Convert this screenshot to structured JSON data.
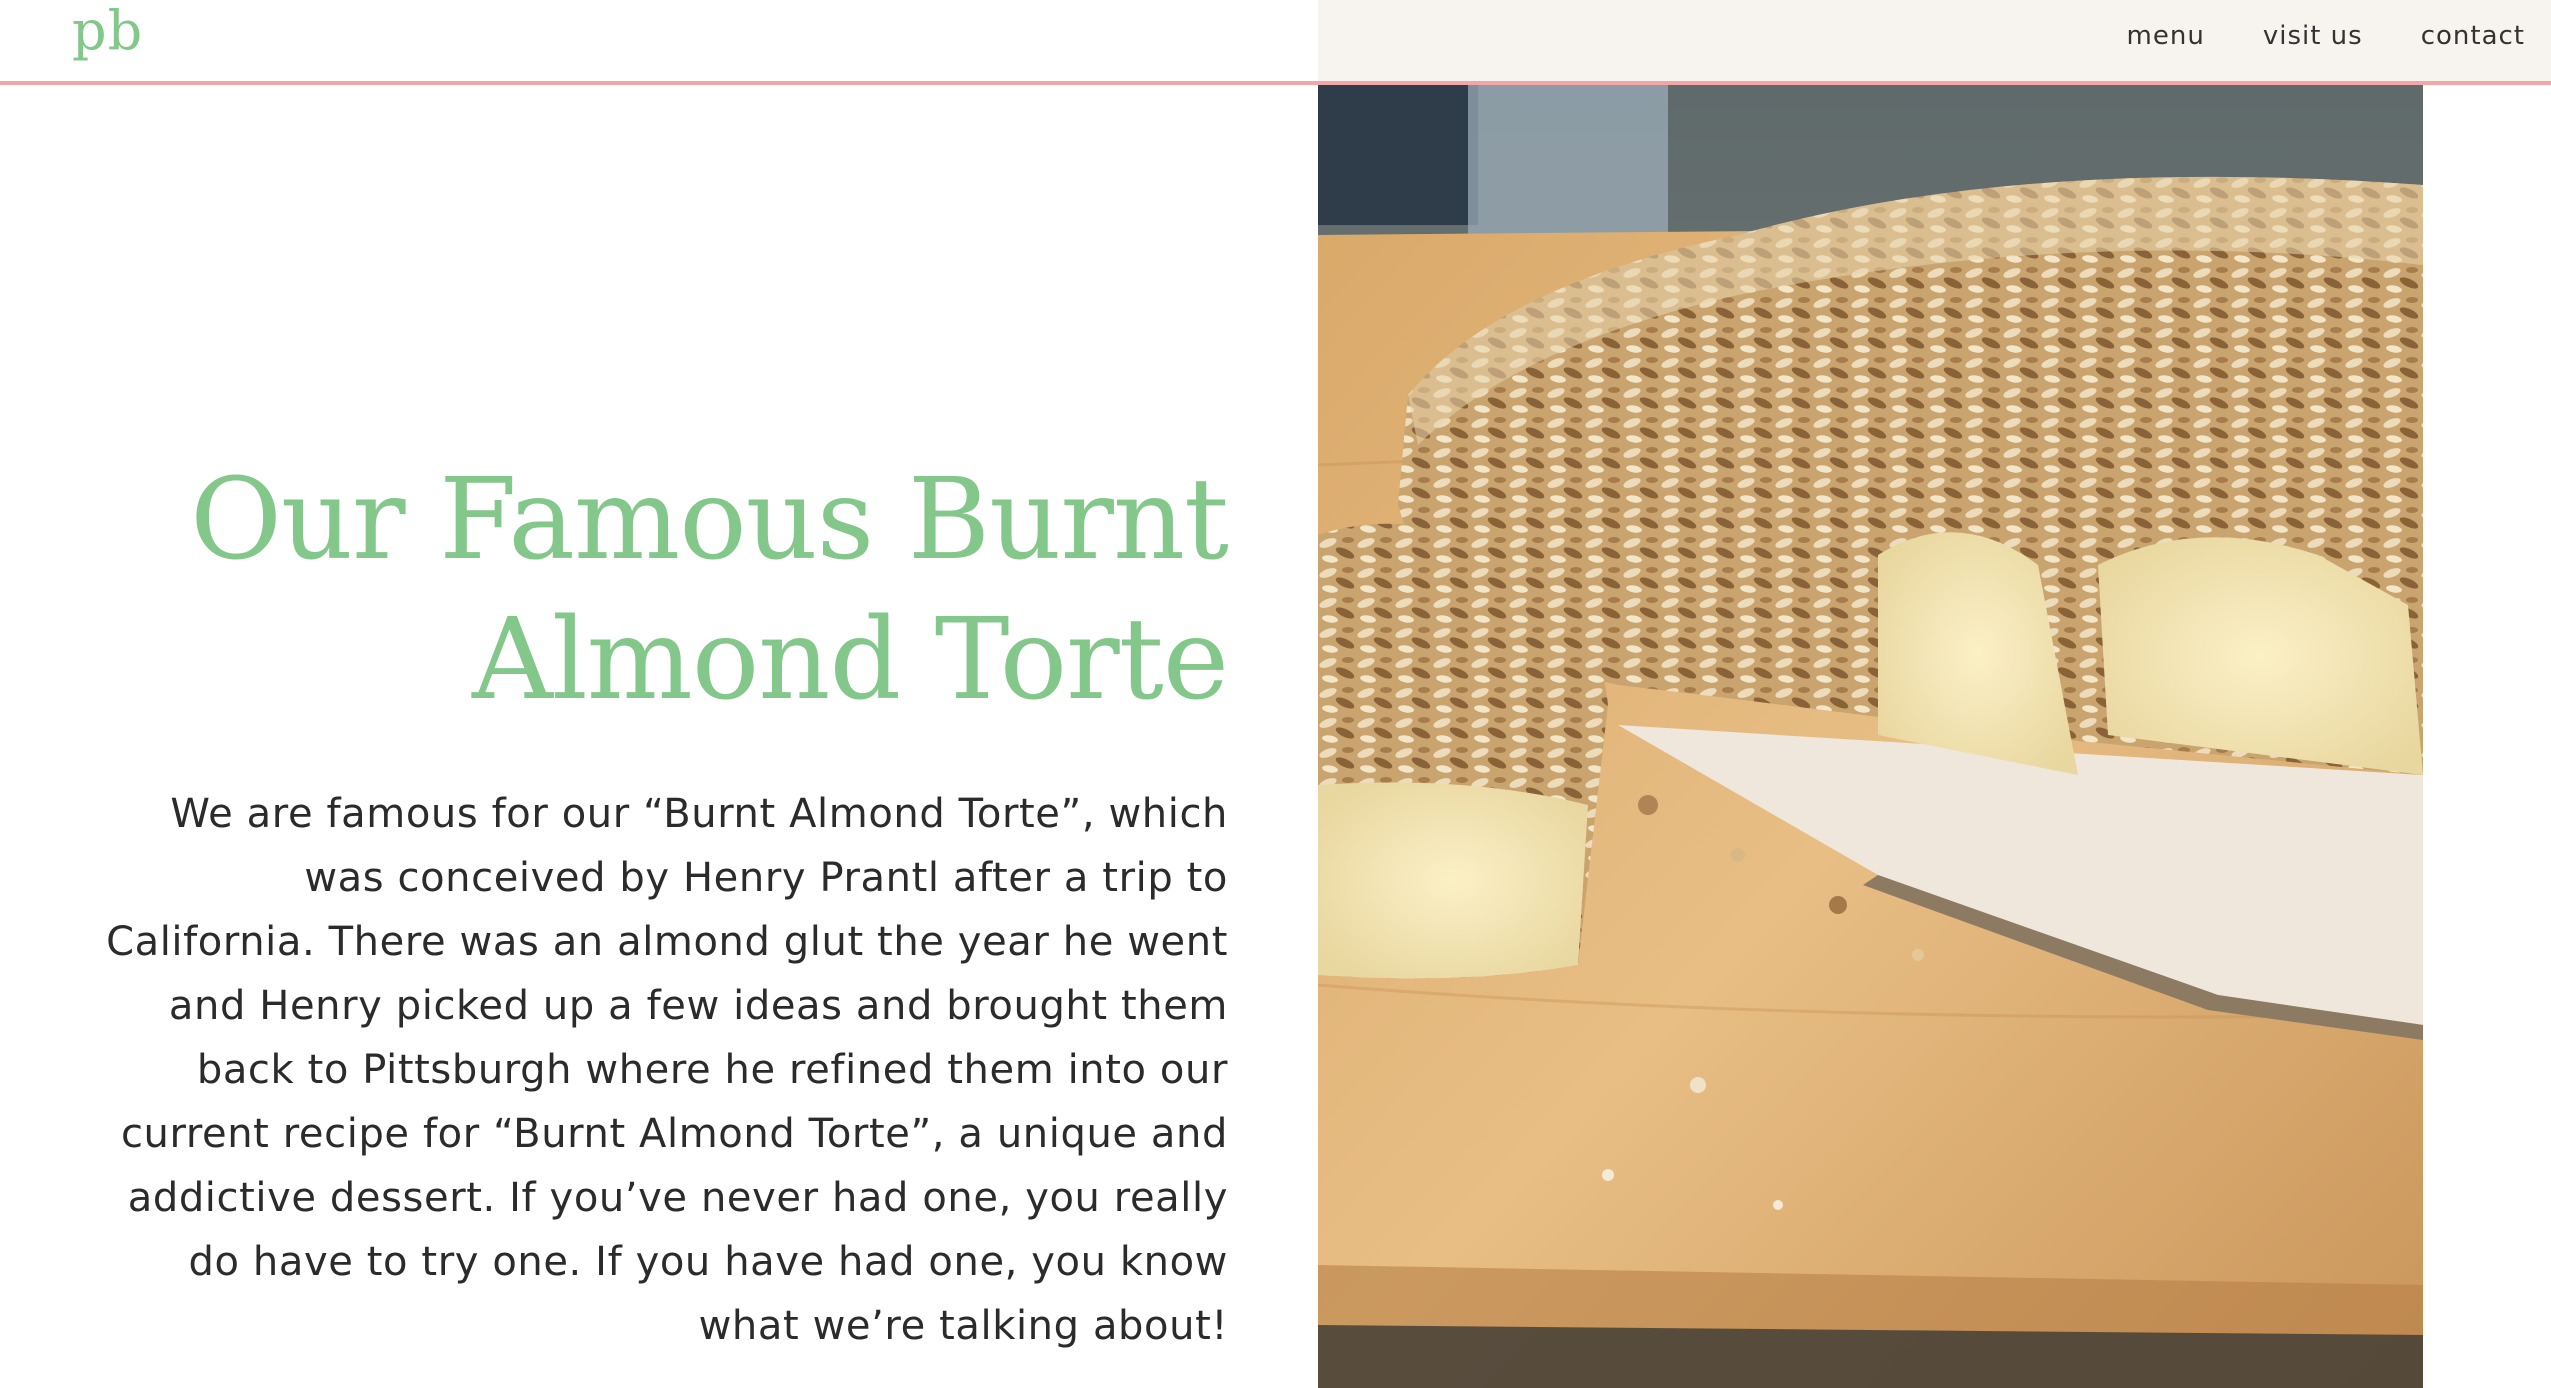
{
  "header": {
    "logo": "pb",
    "nav": [
      {
        "label": "menu"
      },
      {
        "label": "visit us"
      },
      {
        "label": "contact"
      }
    ]
  },
  "hero": {
    "title_line1": "Our Famous Burnt",
    "title_line2": "Almond Torte",
    "description": "We are famous for our “Burnt Almond Torte”, which was conceived by Henry Prantl after a trip to California. There was an almond glut the year he went and Henry picked up a few ideas and brought them back to Pittsburgh where he refined them into our current recipe for “Burnt Almond Torte”, a unique and addictive dessert. If you’ve never had one, you really do have to try one. If you have had one, you know what we’re talking about!"
  },
  "colors": {
    "accent_green": "#83c78b",
    "header_rule_pink": "#f2a6aa",
    "text_dark": "#2b2b2b"
  }
}
